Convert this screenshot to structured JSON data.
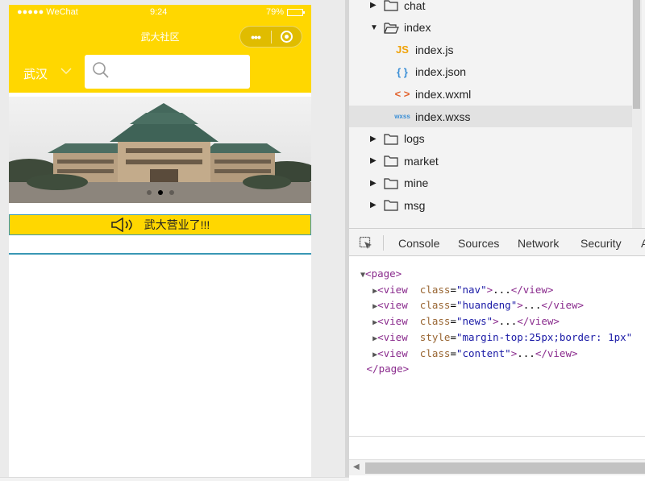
{
  "status_bar": {
    "signal": "●●●●● WeChat",
    "time": "9:24",
    "battery": "79%"
  },
  "navbar": {
    "title": "武大社区",
    "more_label": "•••"
  },
  "search_row": {
    "city": "武汉",
    "search_placeholder": ""
  },
  "banner": {
    "dots_count": 3,
    "active_dot": 1
  },
  "notice": {
    "text": "武大营业了!!!"
  },
  "file_tree": {
    "folders_top": [
      {
        "label": "chat",
        "expanded": false
      },
      {
        "label": "index",
        "expanded": true
      }
    ],
    "files": [
      {
        "icon": "JS",
        "icon_color": "#f0a30a",
        "label": "index.js"
      },
      {
        "icon": "{ }",
        "icon_color": "#3b8fd6",
        "label": "index.json"
      },
      {
        "icon": "< >",
        "icon_color": "#e2622c",
        "label": "index.wxml"
      },
      {
        "icon": "wxss",
        "icon_color": "#3b8fd6",
        "label": "index.wxss",
        "selected": true
      }
    ],
    "folders_bottom": [
      {
        "label": "logs"
      },
      {
        "label": "market"
      },
      {
        "label": "mine"
      },
      {
        "label": "msg"
      }
    ]
  },
  "devtools": {
    "tabs": [
      "Console",
      "Sources",
      "Network",
      "Security",
      "A"
    ],
    "code": {
      "open_tag": "<page>",
      "close_tag": "</page>",
      "lines": [
        {
          "attr": "class",
          "value": "nav"
        },
        {
          "attr": "class",
          "value": "huandeng"
        },
        {
          "attr": "class",
          "value": "news"
        },
        {
          "attr": "style",
          "value": "margin-top:25px;border: 1px"
        },
        {
          "attr": "class",
          "value": "content"
        }
      ]
    }
  },
  "colors": {
    "accent": "#ffd700",
    "divider": "#3a97b4"
  }
}
